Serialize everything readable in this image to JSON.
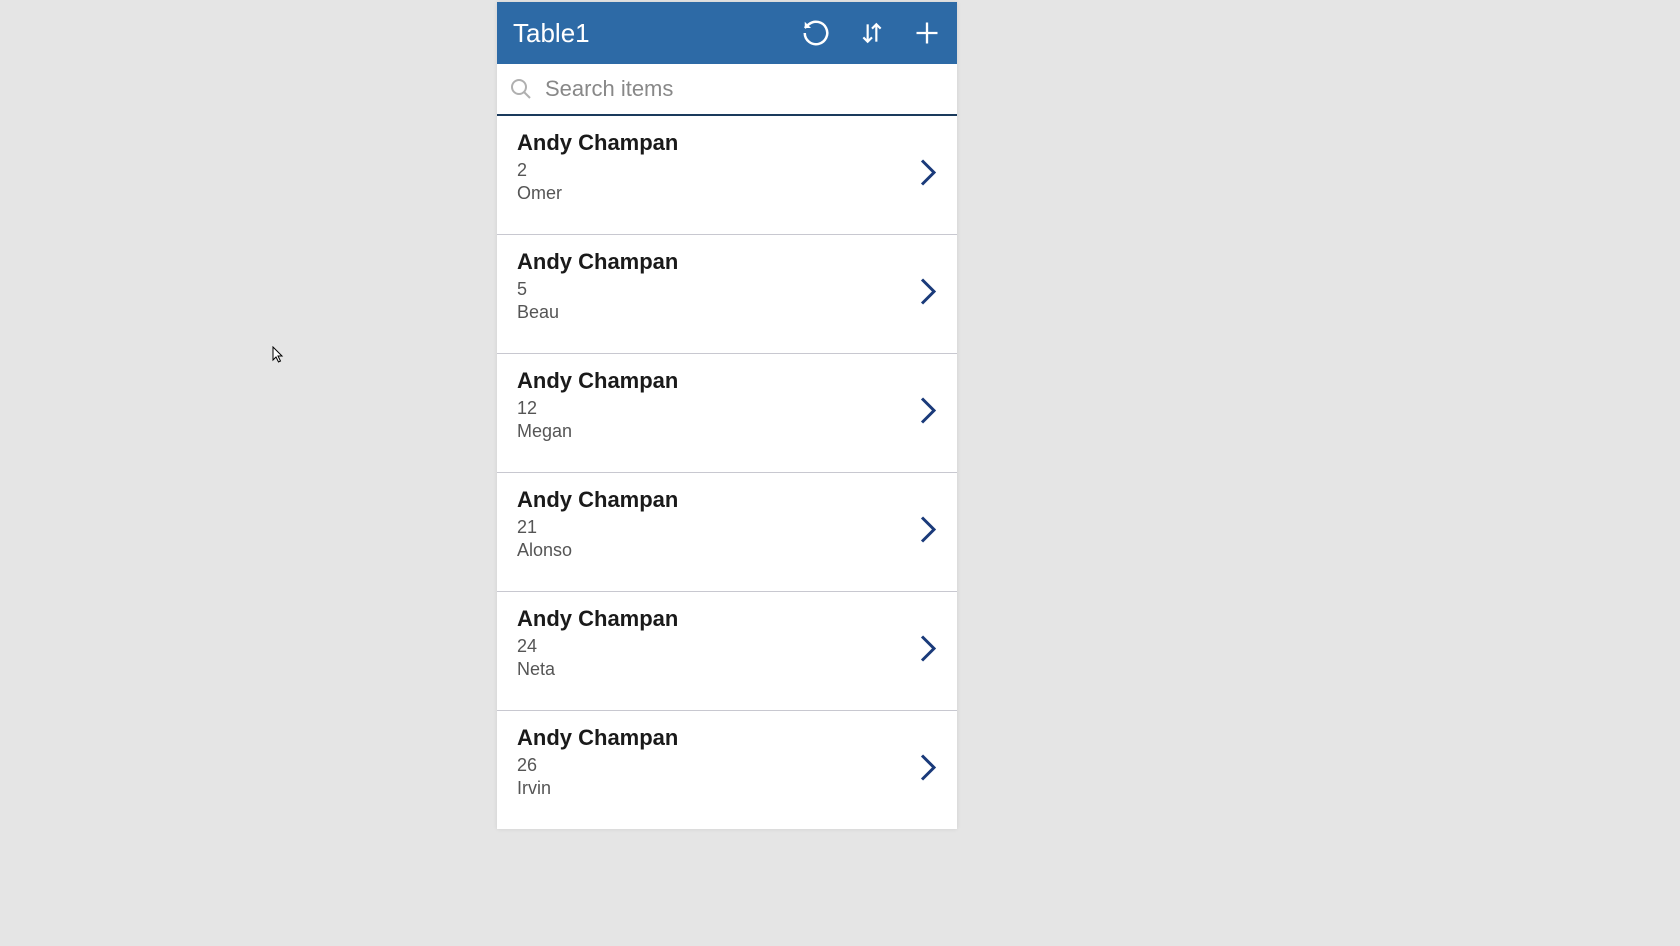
{
  "header": {
    "title": "Table1"
  },
  "search": {
    "placeholder": "Search items",
    "value": ""
  },
  "colors": {
    "header_bg": "#2d6aa6",
    "chevron": "#1a3a7a",
    "search_icon": "#b0b0b0"
  },
  "items": [
    {
      "title": "Andy Champan",
      "number": "2",
      "subtitle": "Omer"
    },
    {
      "title": "Andy Champan",
      "number": "5",
      "subtitle": "Beau"
    },
    {
      "title": "Andy Champan",
      "number": "12",
      "subtitle": "Megan"
    },
    {
      "title": "Andy Champan",
      "number": "21",
      "subtitle": "Alonso"
    },
    {
      "title": "Andy Champan",
      "number": "24",
      "subtitle": "Neta"
    },
    {
      "title": "Andy Champan",
      "number": "26",
      "subtitle": "Irvin"
    }
  ]
}
